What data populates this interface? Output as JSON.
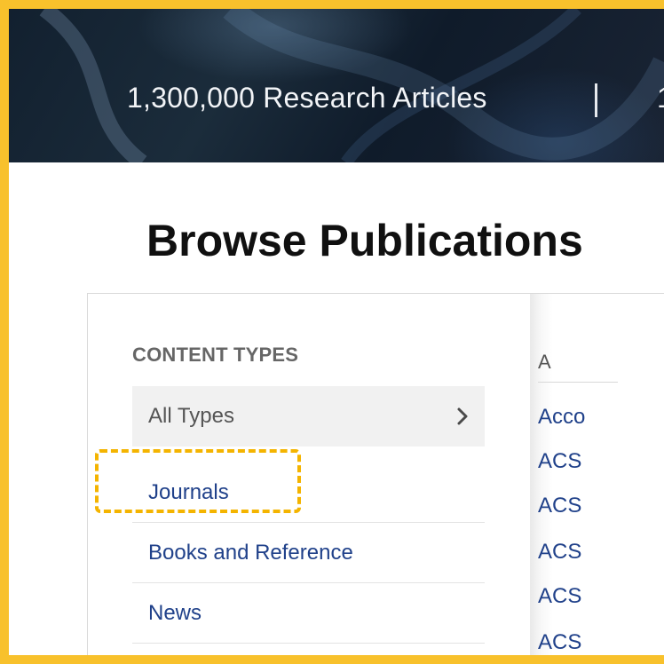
{
  "hero": {
    "stat_primary": "1,300,000 Research Articles",
    "stat_secondary": "1"
  },
  "page": {
    "title": "Browse Publications"
  },
  "content_types": {
    "heading": "CONTENT TYPES",
    "items": [
      {
        "label": "All Types",
        "selected": true
      },
      {
        "label": "Journals",
        "selected": false
      },
      {
        "label": "Books and Reference",
        "selected": false
      },
      {
        "label": "News",
        "selected": false
      }
    ]
  },
  "publications": {
    "letter": "A",
    "items": [
      "Acco",
      "ACS",
      "ACS",
      "ACS",
      "ACS",
      "ACS"
    ]
  },
  "colors": {
    "frame": "#f8c12c",
    "link": "#20418a",
    "highlight": "#f4b400"
  },
  "icons": {
    "all_types_chevron": "chevron-right-icon"
  }
}
